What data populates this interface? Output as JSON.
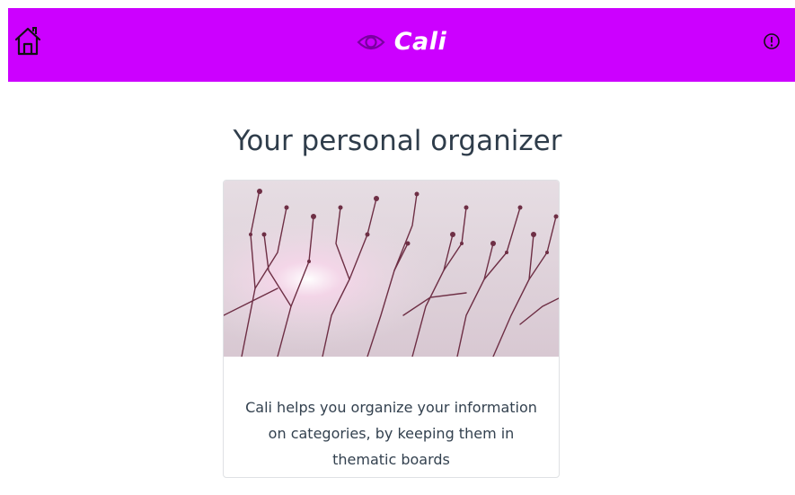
{
  "navbar": {
    "brand_text": "Cali",
    "background": "#cc00ff",
    "home_icon": "home-icon",
    "brand_icon": "eye-icon",
    "info_icon": "info-icon"
  },
  "main": {
    "title": "Your personal organizer"
  },
  "card": {
    "image": "tree-branches-photo",
    "description": "Cali helps you organize your information on categories, by keeping them in thematic boards"
  }
}
